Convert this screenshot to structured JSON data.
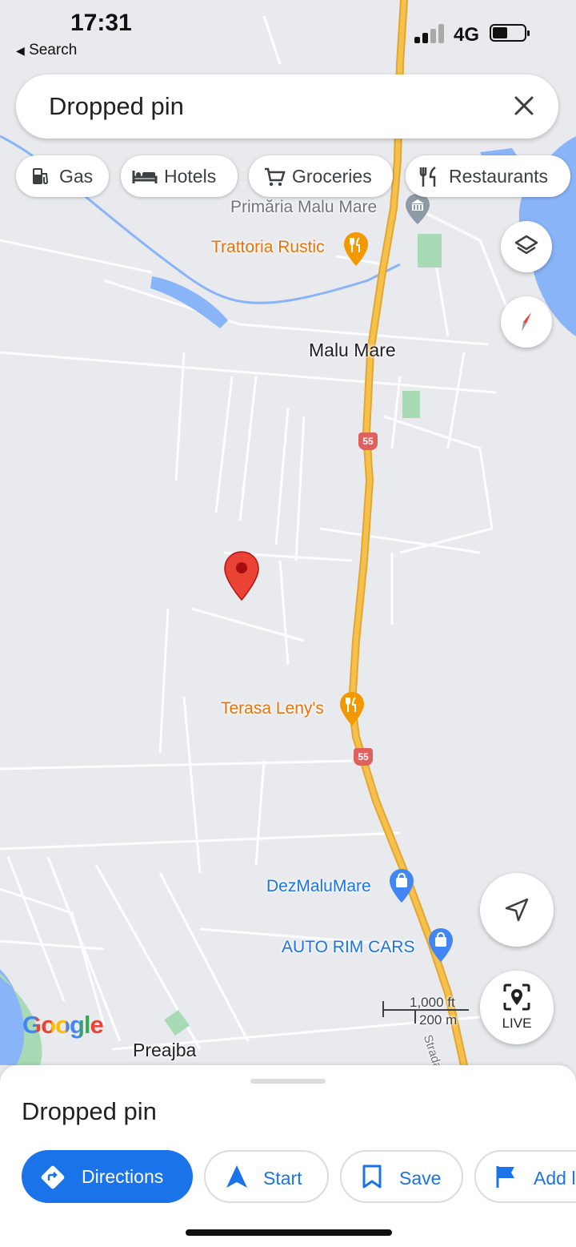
{
  "status_bar": {
    "time": "17:31",
    "back_label": "Search",
    "network": "4G"
  },
  "search": {
    "query": "Dropped pin"
  },
  "category_chips": [
    {
      "label": "Gas",
      "icon": "gas-station-icon"
    },
    {
      "label": "Hotels",
      "icon": "hotel-bed-icon"
    },
    {
      "label": "Groceries",
      "icon": "shopping-cart-icon"
    },
    {
      "label": "Restaurants",
      "icon": "fork-knife-icon"
    }
  ],
  "map": {
    "places": [
      {
        "name": "Primăria Malu Mare",
        "kind": "city-hall"
      },
      {
        "name": "Trattoria Rustic",
        "kind": "restaurant"
      },
      {
        "name": "Malu Mare",
        "kind": "locality"
      },
      {
        "name": "Terasa Leny's",
        "kind": "restaurant"
      },
      {
        "name": "DezMaluMare",
        "kind": "shop"
      },
      {
        "name": "AUTO RIM CARS",
        "kind": "shop"
      },
      {
        "name": "Preajba",
        "kind": "locality"
      }
    ],
    "road_shield": "55",
    "street_label": "Strada Be",
    "scale": {
      "imperial": "1,000 ft",
      "metric": "200 m"
    },
    "google_logo": "Google",
    "live_label": "LIVE",
    "colors": {
      "map_bg": "#e9eaee",
      "highway": "#f6c04d",
      "water": "#8ab4f8",
      "park": "#a8dab5",
      "pin": "#ea4335",
      "accent": "#1a73e8",
      "food": "#e8710a"
    }
  },
  "sheet": {
    "title": "Dropped pin",
    "buttons": [
      {
        "label": "Directions",
        "icon": "directions-icon"
      },
      {
        "label": "Start",
        "icon": "navigation-arrow-icon"
      },
      {
        "label": "Save",
        "icon": "bookmark-icon"
      },
      {
        "label": "Add l",
        "icon": "flag-icon"
      }
    ]
  }
}
